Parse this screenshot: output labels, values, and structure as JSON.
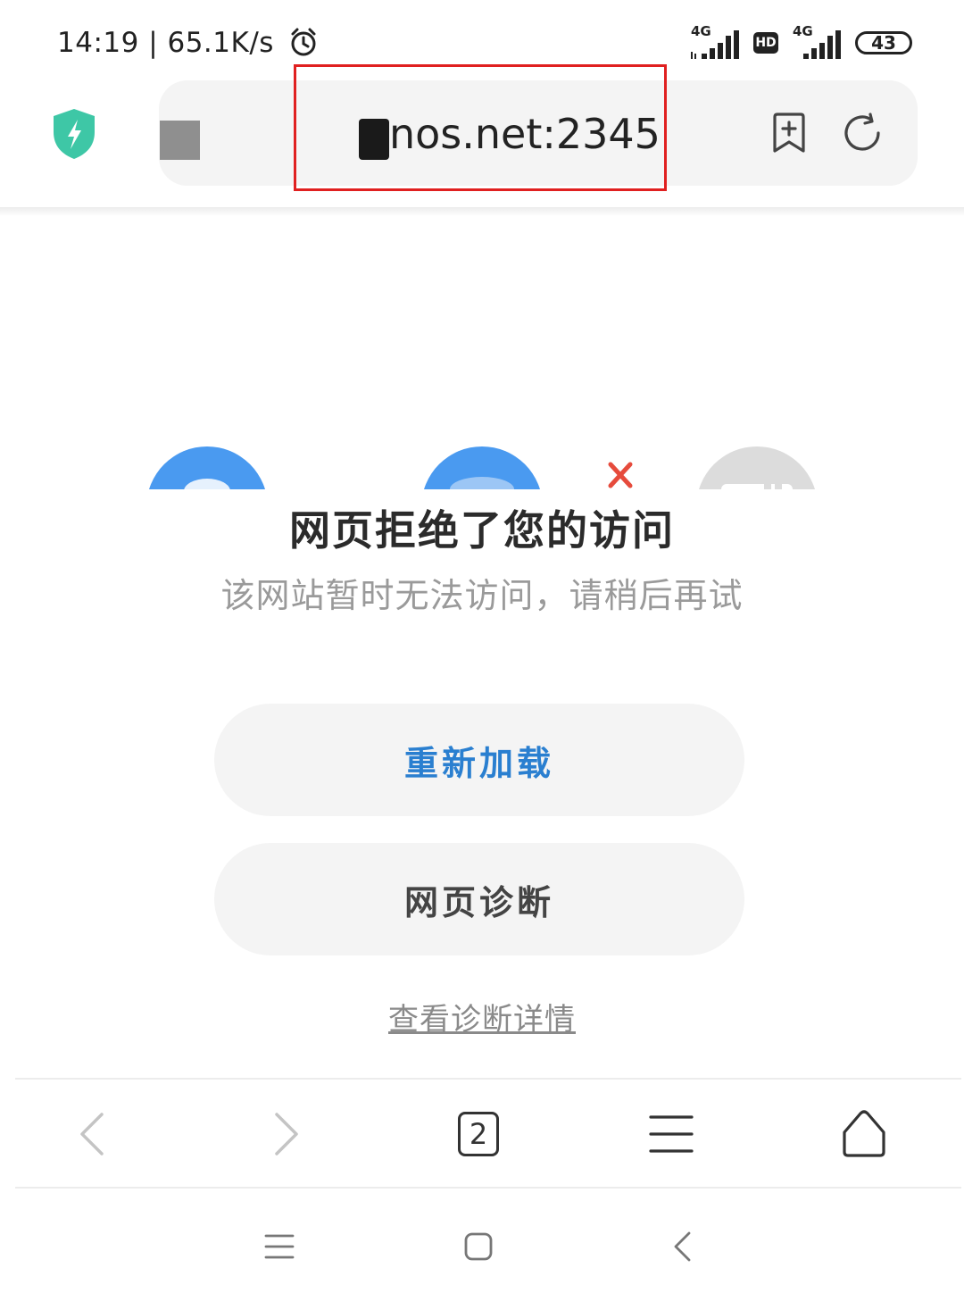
{
  "status_bar": {
    "time_speed": "14:19 | 65.1K/s",
    "network_1": "4G",
    "hd_badge": "HD",
    "network_2": "4G",
    "battery": "43"
  },
  "address_bar": {
    "url": "nos.net:2345"
  },
  "error_page": {
    "title": "网页拒绝了您的访问",
    "subtitle": "该网站暂时无法访问，请稍后再试",
    "reload_label": "重新加载",
    "diagnose_label": "网页诊断",
    "details_link": "查看诊断详情"
  },
  "toolbar": {
    "tab_count": "2"
  },
  "colors": {
    "accent_blue": "#2a7fd0",
    "highlight_red": "#e02020",
    "shield_green": "#3ec7a6"
  }
}
